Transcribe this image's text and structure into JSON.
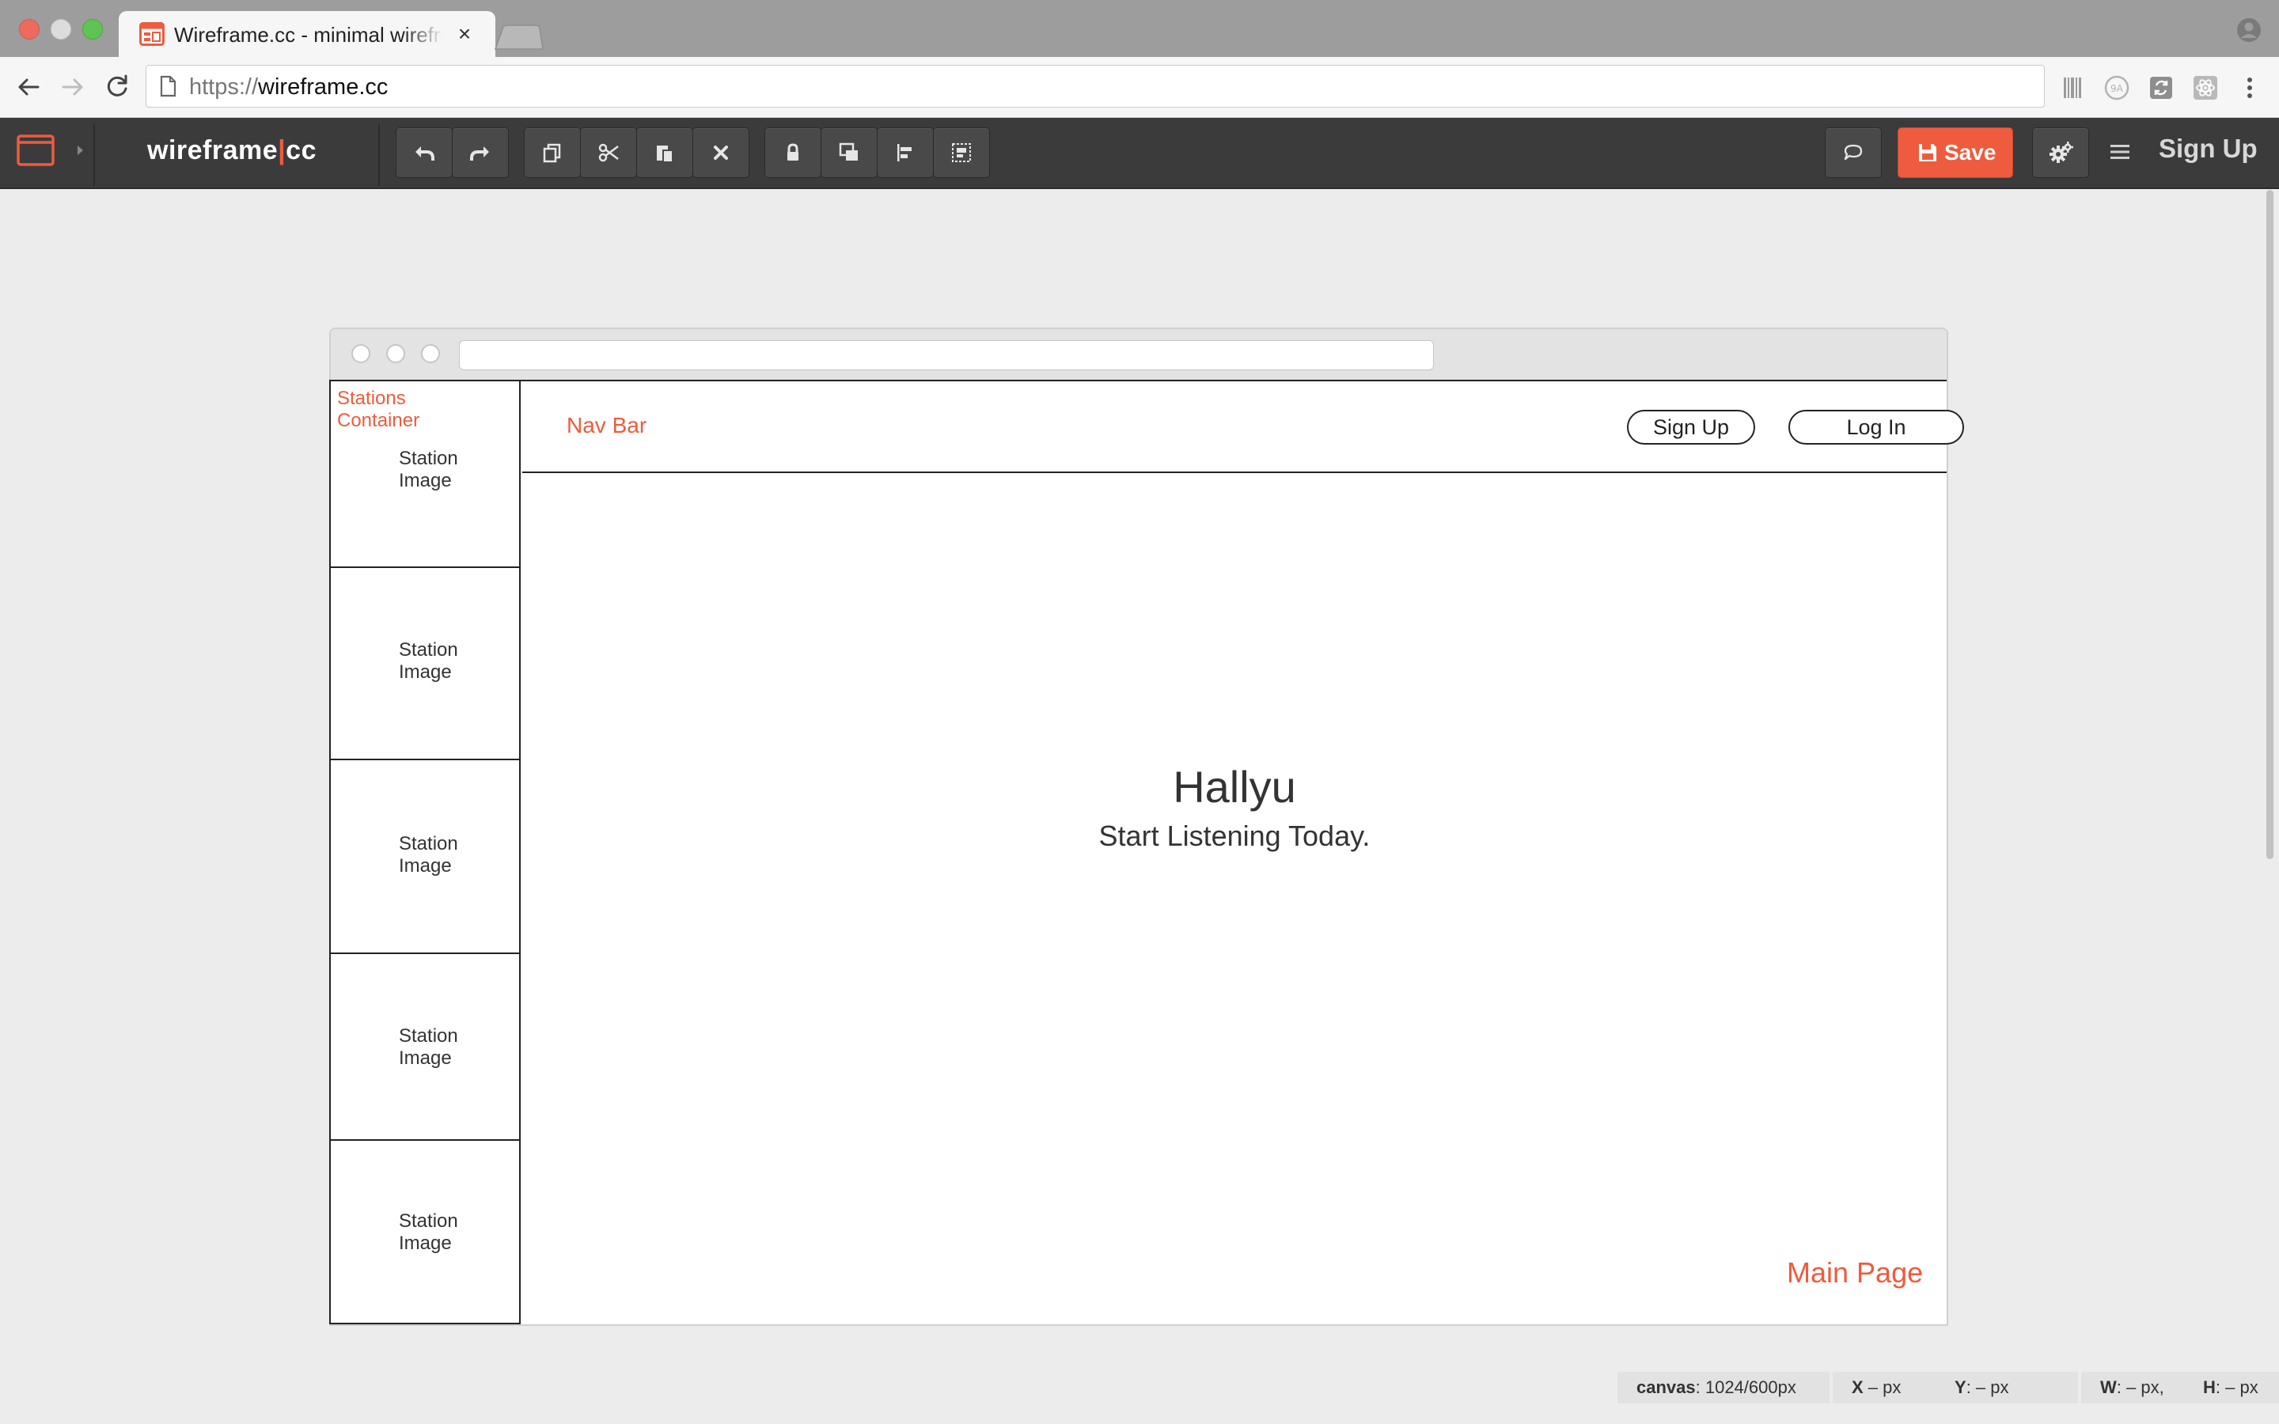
{
  "browser": {
    "tab_title": "Wireframe.cc - minimal wireframing tool",
    "tab_close": "×",
    "url_scheme": "https://",
    "url_host": "wireframe.cc"
  },
  "app": {
    "logo_left": "wireframe",
    "logo_bar": "|",
    "logo_right": "cc",
    "save_label": "Save",
    "signup_label": "Sign Up",
    "accent_color": "#ee5b3e",
    "toolbar_icons": [
      "undo-icon",
      "redo-icon",
      "copy-icon",
      "cut-icon",
      "paste-icon",
      "delete-icon",
      "lock-icon",
      "bring-to-front-icon",
      "align-icon",
      "group-icon"
    ]
  },
  "wireframe": {
    "stations_note_line1": "Stations",
    "stations_note_line2": "Container",
    "station_cells": [
      {
        "line1": "Station",
        "line2": "Image"
      },
      {
        "line1": "Station",
        "line2": "Image"
      },
      {
        "line1": "Station",
        "line2": "Image"
      },
      {
        "line1": "Station",
        "line2": "Image"
      },
      {
        "line1": "Station",
        "line2": "Image"
      }
    ],
    "nav_note": "Nav Bar",
    "signup_button": "Sign Up",
    "login_button": "Log In",
    "hero_title": "Hallyu",
    "hero_subtitle": "Start Listening Today.",
    "main_note": "Main Page"
  },
  "status": {
    "canvas_label": "canvas",
    "canvas_value": ": 1024/600px",
    "x_label": "X",
    "x_value": " – px",
    "y_label": "Y",
    "y_value": ": – px",
    "w_label": "W",
    "w_value": ": – px,",
    "h_label": "H",
    "h_value": ": – px"
  }
}
